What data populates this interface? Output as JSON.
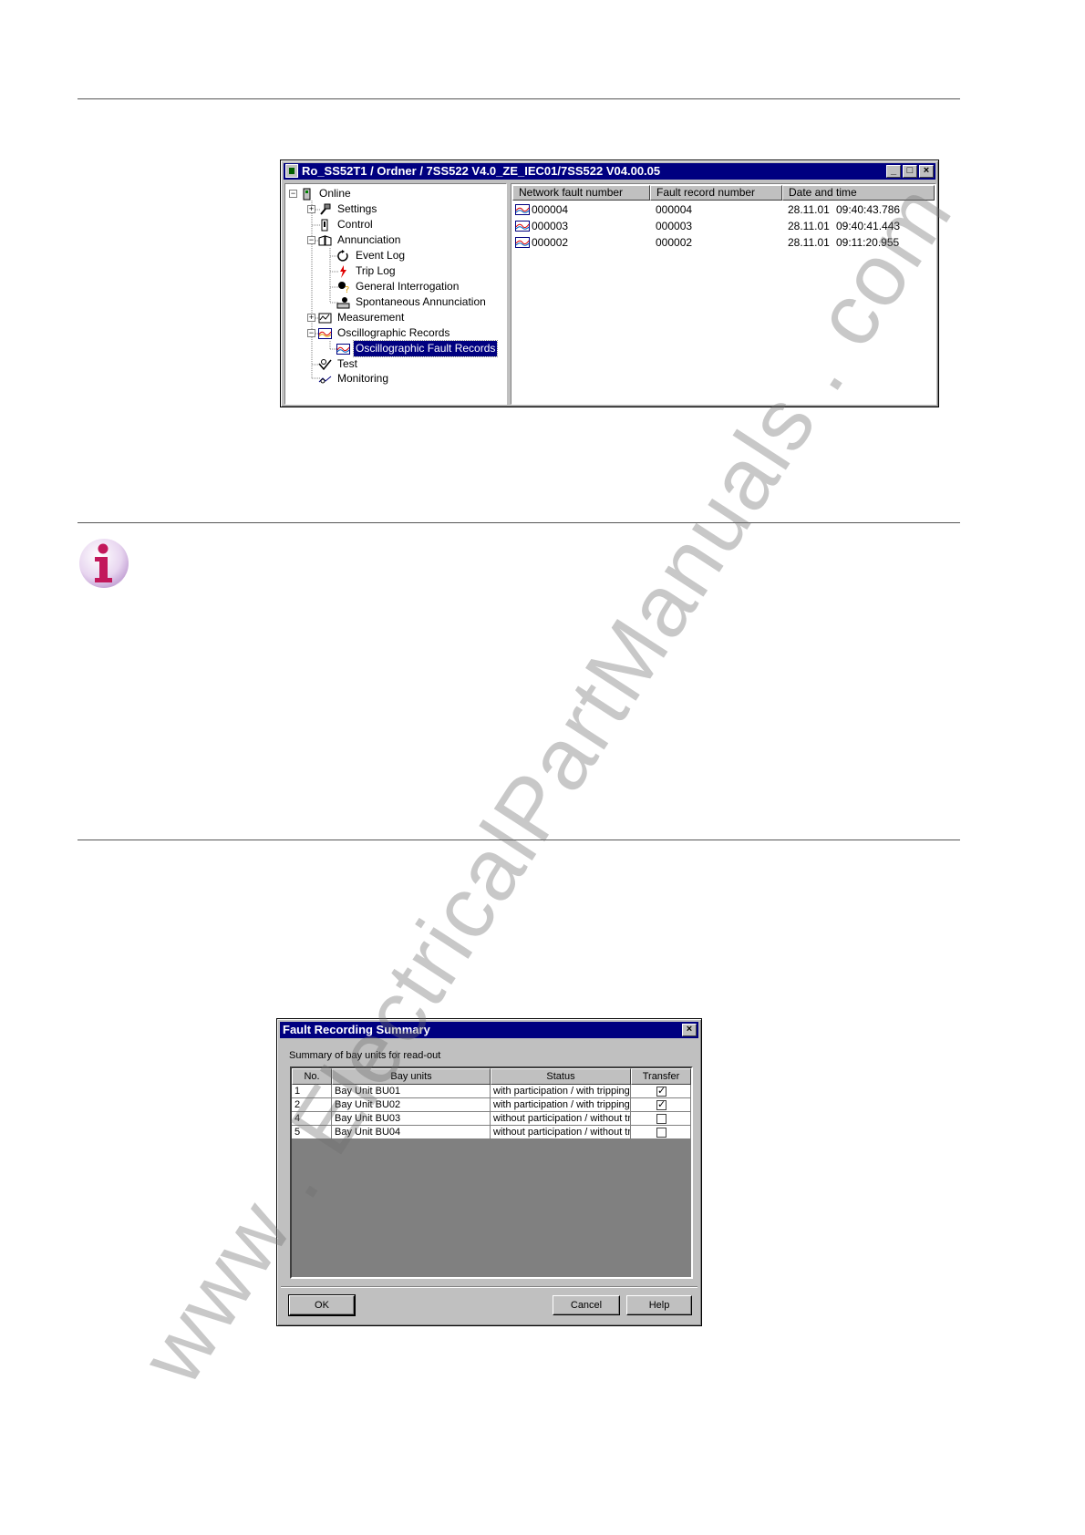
{
  "window1": {
    "title": "Ro_SS52T1 / Ordner / 7SS522 V4.0_ZE_IEC01/7SS522 V04.00.05",
    "tree": [
      {
        "label": "Online"
      },
      {
        "label": "Settings"
      },
      {
        "label": "Control"
      },
      {
        "label": "Annunciation"
      },
      {
        "label": "Event Log"
      },
      {
        "label": "Trip Log"
      },
      {
        "label": "General Interrogation"
      },
      {
        "label": "Spontaneous Annunciation"
      },
      {
        "label": "Measurement"
      },
      {
        "label": "Oscillographic Records"
      },
      {
        "label": "Oscillographic Fault Records"
      },
      {
        "label": "Test"
      },
      {
        "label": "Monitoring"
      }
    ],
    "columns": [
      "Network fault number",
      "Fault record number",
      "Date and time"
    ],
    "rows": [
      {
        "network": "000004",
        "record": "000004",
        "date": "28.11.01",
        "time": "09:40:43.786"
      },
      {
        "network": "000003",
        "record": "000003",
        "date": "28.11.01",
        "time": "09:40:41.443"
      },
      {
        "network": "000002",
        "record": "000002",
        "date": "28.11.01",
        "time": "09:11:20.955"
      }
    ]
  },
  "dialog": {
    "title": "Fault Recording Summary",
    "subtitle": "Summary of bay units for read-out",
    "columns": [
      "No.",
      "Bay units",
      "Status",
      "Transfer"
    ],
    "rows": [
      {
        "no": "1",
        "unit": "Bay Unit BU01",
        "status": "with participation / with tripping",
        "transfer": true
      },
      {
        "no": "2",
        "unit": "Bay Unit BU02",
        "status": "with participation / with tripping",
        "transfer": true
      },
      {
        "no": "4",
        "unit": "Bay Unit BU03",
        "status": "without participation / without tri",
        "transfer": false
      },
      {
        "no": "5",
        "unit": "Bay Unit BU04",
        "status": "without participation / without tri",
        "transfer": false
      }
    ],
    "buttons": {
      "ok": "OK",
      "cancel": "Cancel",
      "help": "Help"
    }
  },
  "watermark": "www . ElectricalPartManuals . com",
  "colors": {
    "titlebar": "#000080",
    "info_icon": "#c2185b"
  }
}
